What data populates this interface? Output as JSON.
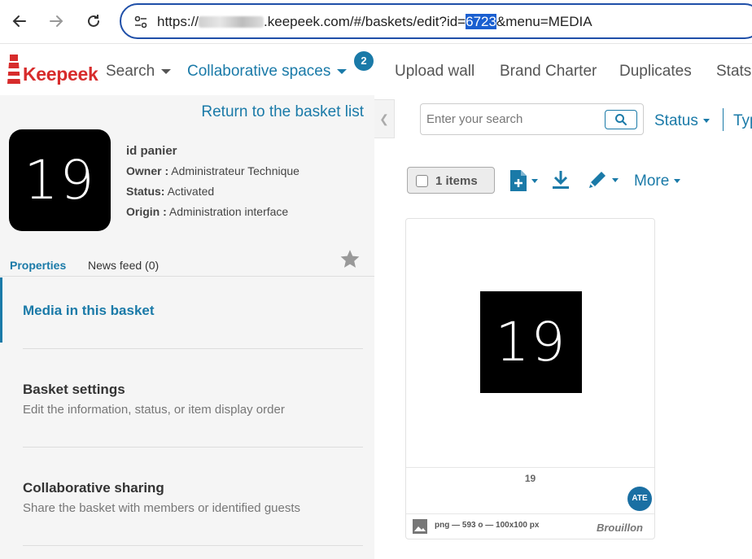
{
  "browser": {
    "url_prefix": "https://",
    "url_domain": ".keepeek.com/#/baskets/edit?id=",
    "url_id": "6723",
    "url_suffix": "&menu=MEDIA"
  },
  "header": {
    "logo_text": "Keepeek",
    "nav": [
      {
        "label": "Search"
      },
      {
        "label": "Collaborative spaces",
        "badge": "2"
      },
      {
        "label": "Upload wall"
      },
      {
        "label": "Brand Charter"
      },
      {
        "label": "Duplicates"
      },
      {
        "label": "Stats"
      }
    ]
  },
  "basket": {
    "return_link": "Return to the basket list",
    "thumb_text": "19",
    "name": "id panier",
    "owner_label": "Owner :",
    "owner": "Administrateur Technique",
    "status_label": "Status:",
    "status": "Activated",
    "origin_label": "Origin :",
    "origin": "Administration interface",
    "tabs": [
      {
        "label": "Properties"
      },
      {
        "label": "News feed (0)"
      }
    ],
    "menu": [
      {
        "title": "Media in this basket",
        "desc": ""
      },
      {
        "title": "Basket settings",
        "desc": "Edit the information, status, or item display order"
      },
      {
        "title": "Collaborative sharing",
        "desc": "Share the basket with members or identified guests"
      }
    ]
  },
  "toolbar": {
    "search_placeholder": "Enter your search",
    "status_filter": "Status",
    "type_filter": "Typ",
    "items_label": "1 items",
    "more_label": "More"
  },
  "media_card": {
    "thumb_text": "19",
    "title": "19",
    "user_badge": "ATE",
    "meta": "png — 593 o — 100x100 px",
    "status": "Brouillon"
  },
  "colors": {
    "brand_blue": "#1a7aa8",
    "logo_red": "#d72c2c",
    "panel_bg": "#f5f5f5"
  }
}
